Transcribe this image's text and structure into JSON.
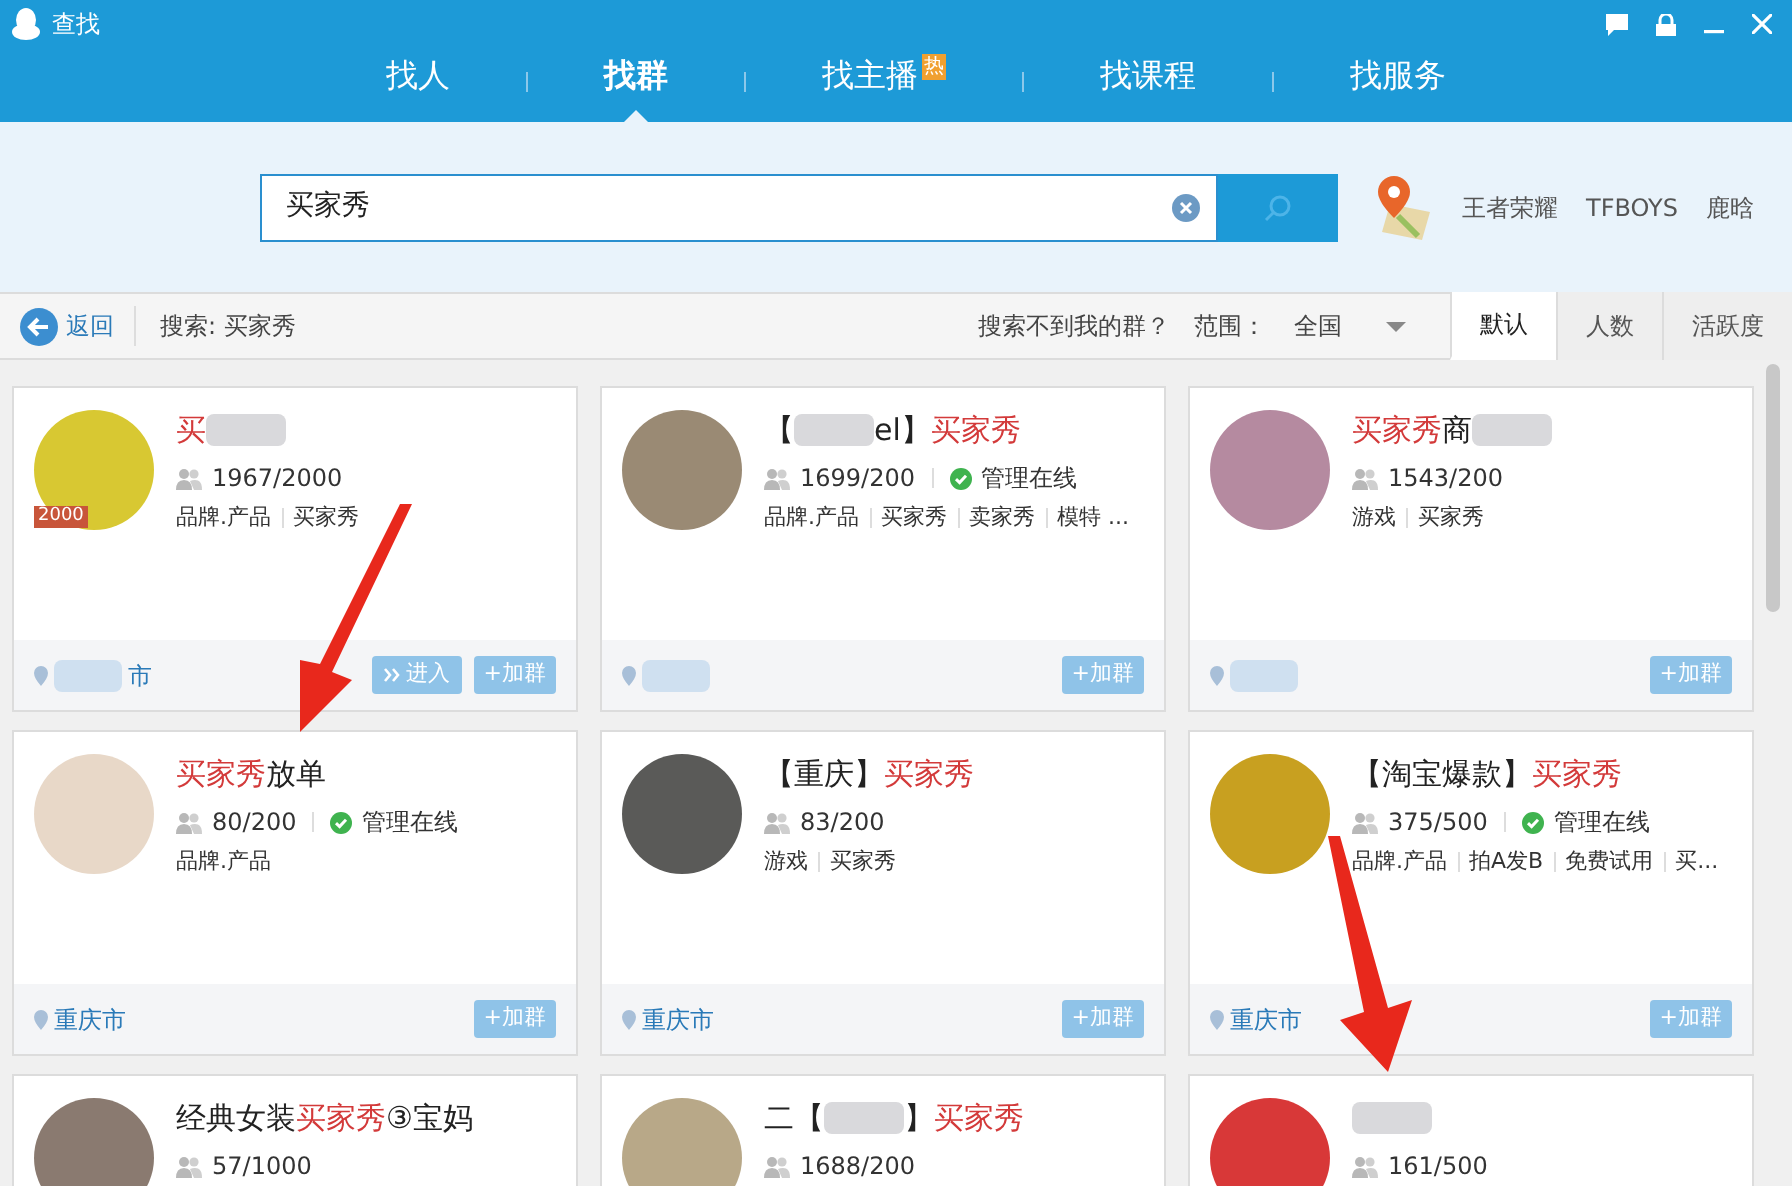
{
  "window": {
    "title": "查找"
  },
  "nav_tabs": [
    {
      "label": "找人",
      "selected": false
    },
    {
      "label": "找群",
      "selected": true
    },
    {
      "label": "找主播",
      "selected": false,
      "badge": "热"
    },
    {
      "label": "找课程",
      "selected": false
    },
    {
      "label": "找服务",
      "selected": false
    }
  ],
  "search": {
    "value": "买家秀"
  },
  "hot_searches": [
    "王者荣耀",
    "TFBOYS",
    "鹿晗"
  ],
  "toolbar": {
    "back": "返回",
    "query": "搜索: 买家秀",
    "help_link": "搜索不到我的群？",
    "scope_label": "范围：",
    "scope_value": "全国",
    "sort_tabs": [
      {
        "label": "默认",
        "selected": true
      },
      {
        "label": "人数",
        "selected": false
      },
      {
        "label": "活跃度",
        "selected": false
      }
    ]
  },
  "cards": [
    {
      "title": [
        {
          "kind": "match",
          "text": "买"
        },
        {
          "kind": "blur"
        }
      ],
      "avatar_badge": "2000",
      "count": "1967/2000",
      "tags": [
        "品牌.产品",
        "买家秀"
      ],
      "location": [
        {
          "kind": "blur"
        },
        {
          "kind": "plain",
          "text": "市"
        }
      ],
      "enter_button": "进入",
      "join_button": "+加群"
    },
    {
      "title": [
        {
          "kind": "plain",
          "text": "【"
        },
        {
          "kind": "blur"
        },
        {
          "kind": "plain",
          "text": "el】"
        },
        {
          "kind": "match",
          "text": "买家秀"
        }
      ],
      "count": "1699/200",
      "admin_label": "管理在线",
      "tags": [
        "品牌.产品",
        "买家秀",
        "卖家秀",
        "模特 ..."
      ],
      "location": [
        {
          "kind": "blur"
        }
      ],
      "join_button": "+加群"
    },
    {
      "title": [
        {
          "kind": "match",
          "text": "买家秀"
        },
        {
          "kind": "plain",
          "text": "商"
        },
        {
          "kind": "blur"
        }
      ],
      "count": "1543/200",
      "tags": [
        "游戏",
        "买家秀"
      ],
      "location": [
        {
          "kind": "blur"
        }
      ],
      "join_button": "+加群"
    },
    {
      "title": [
        {
          "kind": "match",
          "text": "买家秀"
        },
        {
          "kind": "plain",
          "text": "放单"
        }
      ],
      "count": "80/200",
      "admin_label": "管理在线",
      "tags": [
        "品牌.产品"
      ],
      "location": [
        {
          "kind": "plain",
          "text": "重庆市"
        }
      ],
      "join_button": "+加群"
    },
    {
      "title": [
        {
          "kind": "plain",
          "text": "【重庆】"
        },
        {
          "kind": "match",
          "text": "买家秀"
        }
      ],
      "count": "83/200",
      "tags": [
        "游戏",
        "买家秀"
      ],
      "location": [
        {
          "kind": "plain",
          "text": "重庆市"
        }
      ],
      "join_button": "+加群"
    },
    {
      "title": [
        {
          "kind": "plain",
          "text": "【淘宝爆款】"
        },
        {
          "kind": "match",
          "text": "买家秀"
        }
      ],
      "count": "375/500",
      "admin_label": "管理在线",
      "tags": [
        "品牌.产品",
        "拍A发B",
        "免费试用",
        "买..."
      ],
      "location": [
        {
          "kind": "plain",
          "text": "重庆市"
        }
      ],
      "join_button": "+加群"
    },
    {
      "title": [
        {
          "kind": "plain",
          "text": "经典女装"
        },
        {
          "kind": "match",
          "text": "买家秀"
        },
        {
          "kind": "plain",
          "text": "③宝妈"
        }
      ],
      "count": "57/1000"
    },
    {
      "title": [
        {
          "kind": "plain",
          "text": "二【"
        },
        {
          "kind": "blur"
        },
        {
          "kind": "plain",
          "text": "】"
        },
        {
          "kind": "match",
          "text": "买家秀"
        }
      ],
      "count": "1688/200"
    },
    {
      "title": [
        {
          "kind": "blur"
        }
      ],
      "count": "161/500"
    }
  ]
}
